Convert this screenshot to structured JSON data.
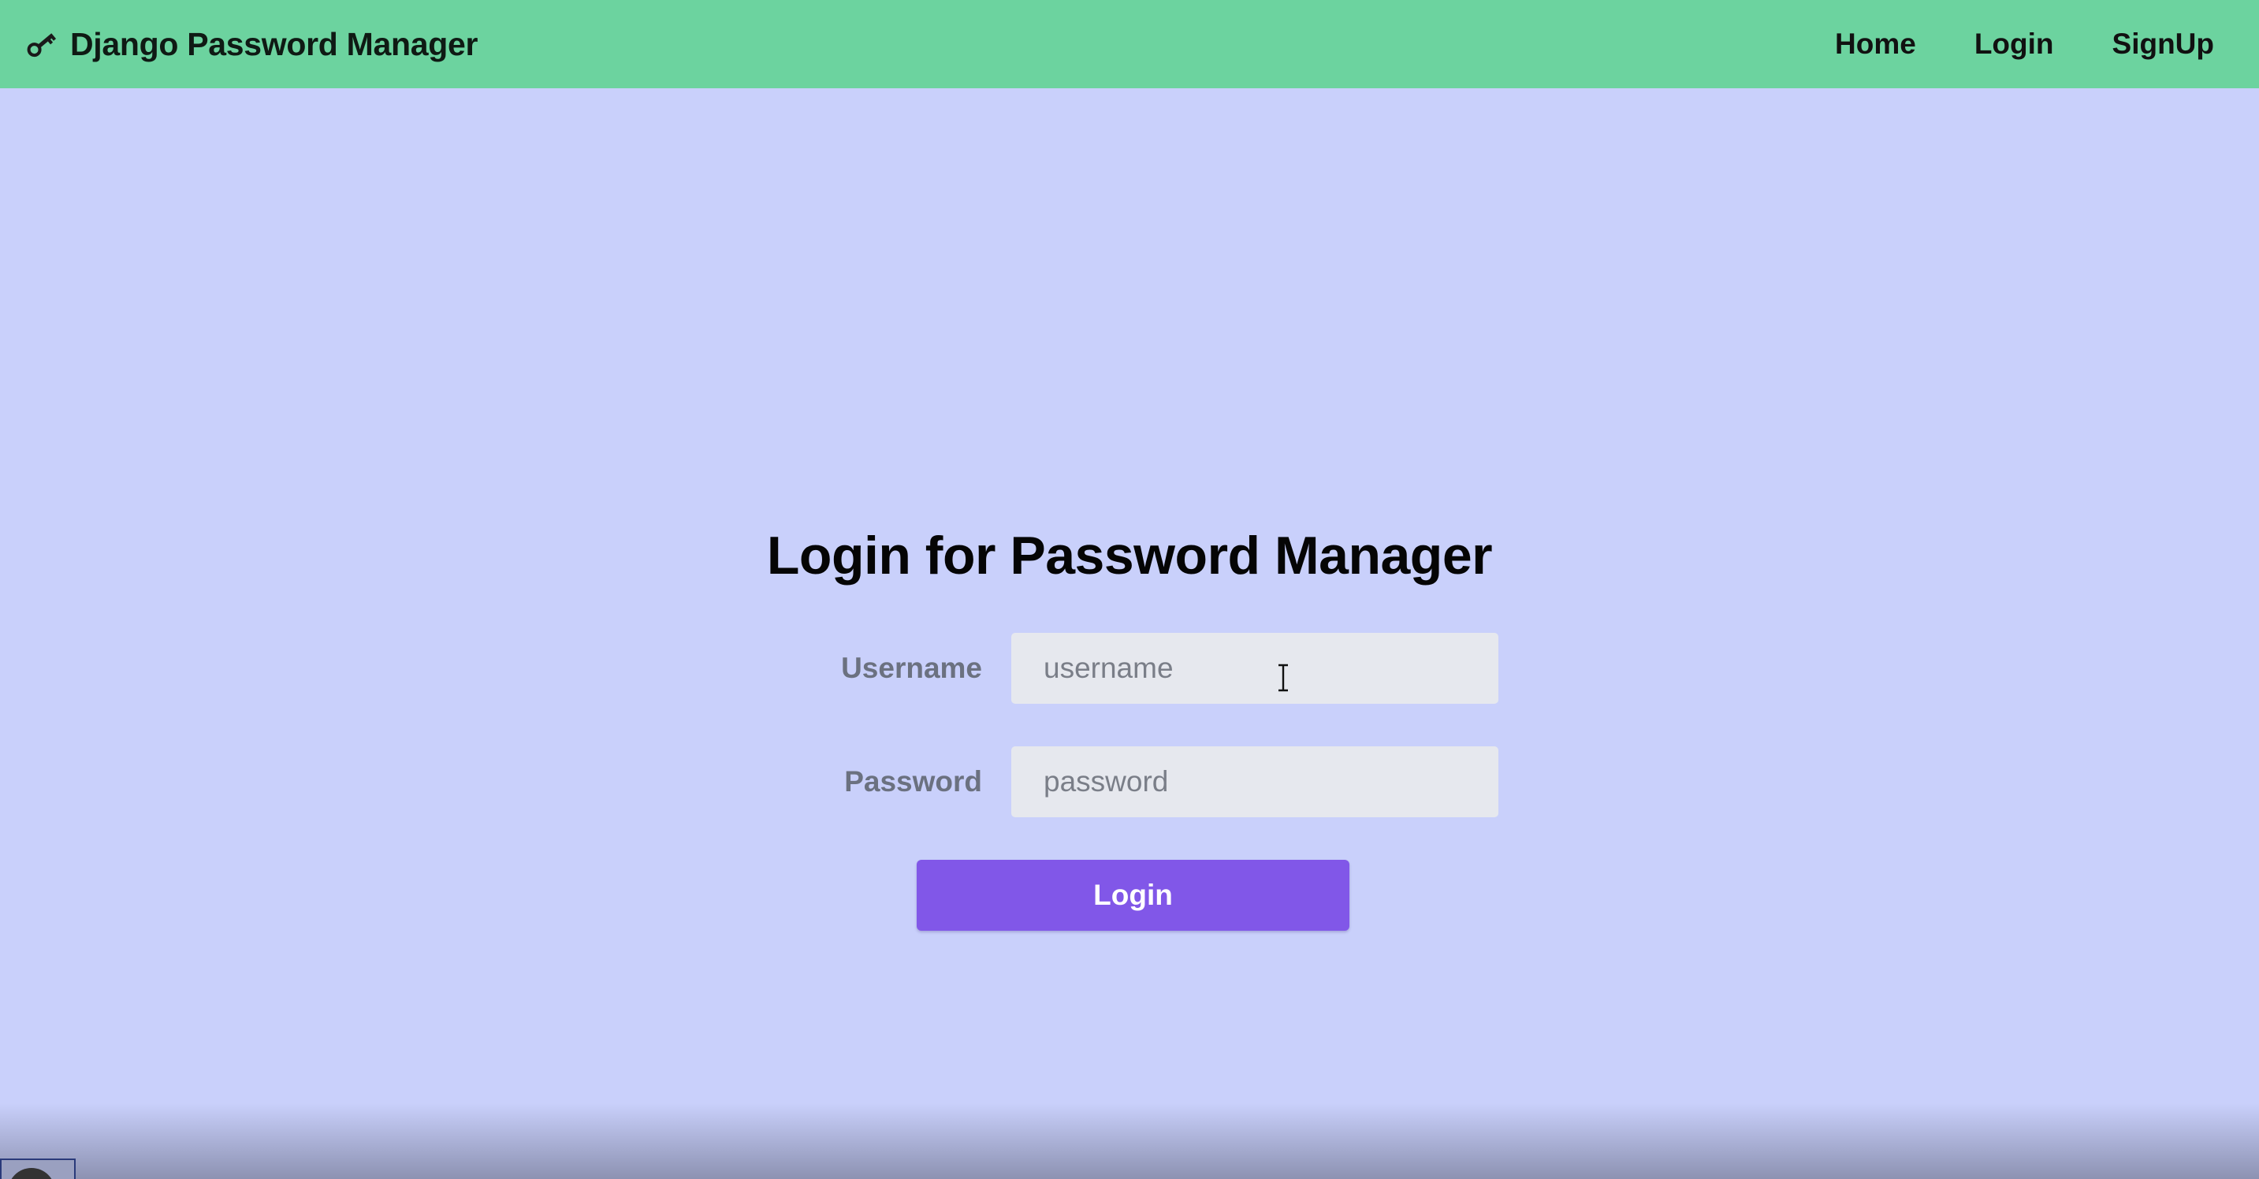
{
  "navbar": {
    "brand_icon": "key-icon",
    "brand_title": "Django Password Manager",
    "links": [
      {
        "label": "Home"
      },
      {
        "label": "Login"
      },
      {
        "label": "SignUp"
      }
    ],
    "background_color": "#6cd39f"
  },
  "page": {
    "background_color": "#c9d0fb",
    "title": "Login for Password Manager"
  },
  "form": {
    "username": {
      "label": "Username",
      "placeholder": "username",
      "value": ""
    },
    "password": {
      "label": "Password",
      "placeholder": "password",
      "value": ""
    },
    "submit_label": "Login",
    "submit_color": "#8157e8"
  },
  "cursor": {
    "type": "text-cursor-icon"
  }
}
